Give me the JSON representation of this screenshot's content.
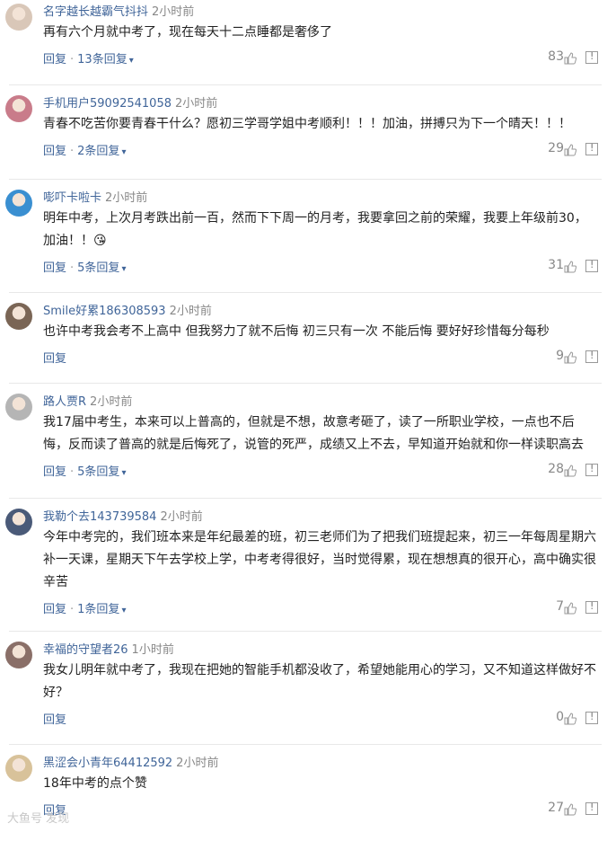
{
  "comments": [
    {
      "user": "名字越长越霸气抖抖",
      "time": "2小时前",
      "lines": [
        "再有六个月就中考了，现在每天十二点睡都是奢侈了"
      ],
      "reply": "回复",
      "replies": "13条回复",
      "likes": "83",
      "avatar_color": "#d9c7b8"
    },
    {
      "user": "手机用户59092541058",
      "time": "2小时前",
      "lines": [
        "青春不吃苦你要青春干什么？愿初三学哥学姐中考顺利！！！加油，拼搏只为下一个晴天！！！"
      ],
      "reply": "回复",
      "replies": "2条回复",
      "likes": "29",
      "avatar_color": "#c97c8a"
    },
    {
      "user": "嘭吓卡啦卡",
      "time": "2小时前",
      "lines": [
        "明年中考，上次月考跌出前一百，然而下下周一的月考，我要拿回之前的荣耀，我要上年级前30，",
        "加油！！😘"
      ],
      "reply": "回复",
      "replies": "5条回复",
      "likes": "31",
      "avatar_color": "#3a8fd1"
    },
    {
      "user": "Smile好累186308593",
      "time": "2小时前",
      "lines": [
        "也许中考我会考不上高中 但我努力了就不后悔 初三只有一次 不能后悔 要好好珍惜每分每秒"
      ],
      "reply": "回复",
      "replies": "",
      "likes": "9",
      "avatar_color": "#7a6555"
    },
    {
      "user": "路人贾R",
      "time": "2小时前",
      "lines": [
        "我17届中考生，本来可以上普高的，但就是不想，故意考砸了，读了一所职业学校，一点也不后",
        "悔，反而读了普高的就是后悔死了，说管的死严，成绩又上不去，早知道开始就和你一样读职高去"
      ],
      "reply": "回复",
      "replies": "5条回复",
      "likes": "28",
      "avatar_color": "#b5b5b5"
    },
    {
      "user": "我勒个去143739584",
      "time": "2小时前",
      "lines": [
        "今年中考完的，我们班本来是年纪最差的班，初三老师们为了把我们班提起来，初三一年每周星期六",
        "补一天课，星期天下午去学校上学，中考考得很好，当时觉得累，现在想想真的很开心，高中确实很",
        "辛苦"
      ],
      "reply": "回复",
      "replies": "1条回复",
      "likes": "7",
      "avatar_color": "#4a5a78"
    },
    {
      "user": "幸福的守望者26",
      "time": "1小时前",
      "lines": [
        "我女儿明年就中考了，我现在把她的智能手机都没收了，希望她能用心的学习，又不知道这样做好不",
        "好？"
      ],
      "reply": "回复",
      "replies": "",
      "likes": "0",
      "avatar_color": "#8a6f68"
    },
    {
      "user": "黑涩会小青年64412592",
      "time": "2小时前",
      "lines": [
        "18年中考的点个赞"
      ],
      "reply": "回复",
      "replies": "",
      "likes": "27",
      "avatar_color": "#d8c29a"
    }
  ],
  "watermark": "大鱼号 发现",
  "icons": {
    "like": "thumbs-up-icon",
    "report": "report-icon",
    "chevron": "chevron-down-icon"
  }
}
